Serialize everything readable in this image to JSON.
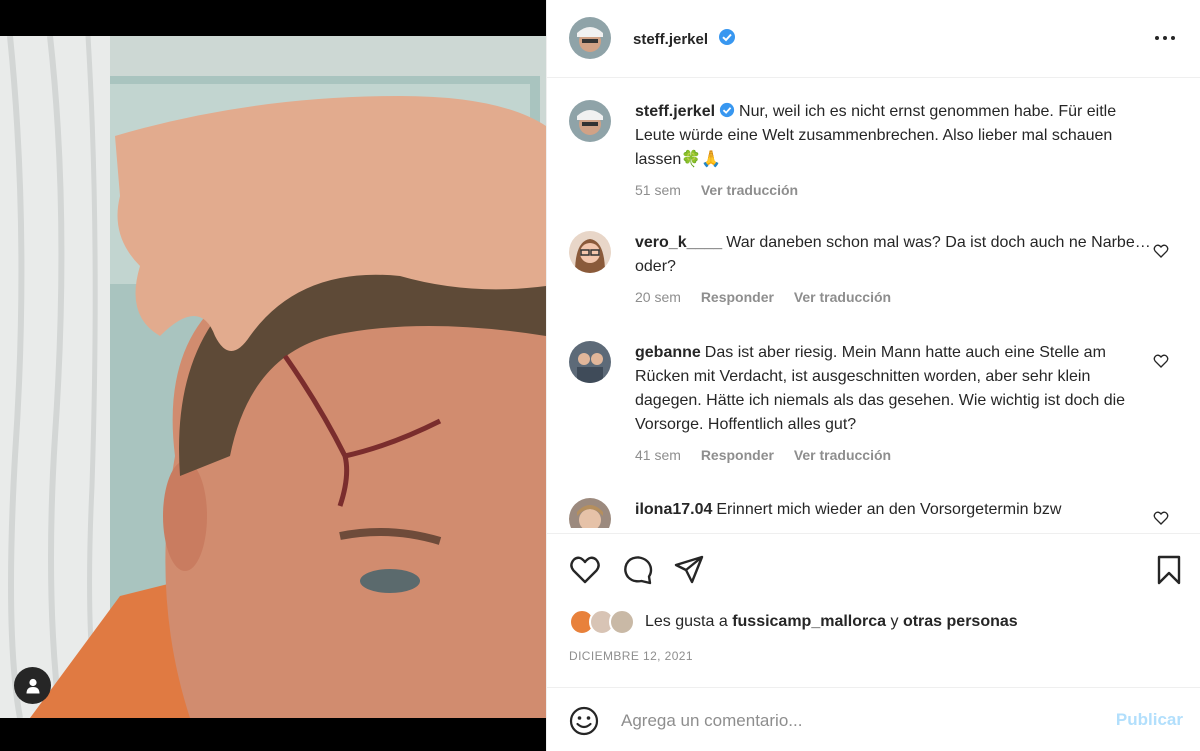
{
  "post": {
    "username": "steff.jerkel",
    "verified": true,
    "caption": "Nur, weil ich es nicht ernst genommen habe. Für eitle Leute würde eine Welt zusammenbrechen. Also lieber mal schauen lassen🍀🙏",
    "caption_time": "51 sem",
    "translate_label": "Ver traducción"
  },
  "comments": [
    {
      "username": "vero_k____",
      "text": "War daneben schon mal was? Da ist doch auch ne Narbe…oder?",
      "time": "20 sem",
      "reply_label": "Responder",
      "translate_label": "Ver traducción"
    },
    {
      "username": "gebanne",
      "text": "Das ist aber riesig. Mein Mann hatte auch eine Stelle am Rücken mit Verdacht, ist ausgeschnitten worden, aber sehr klein dagegen. Hätte ich niemals als das gesehen. Wie wichtig ist doch die Vorsorge. Hoffentlich alles gut?",
      "time": "41 sem",
      "reply_label": "Responder",
      "translate_label": "Ver traducción"
    },
    {
      "username": "ilona17.04",
      "text": "Erinnert mich wieder an den Vorsorgetermin bzw"
    }
  ],
  "likes": {
    "prefix": "Les gusta a",
    "user": "fussicamp_mallorca",
    "joiner": "y",
    "others": "otras personas"
  },
  "date": "DICIEMBRE 12, 2021",
  "add_comment": {
    "placeholder": "Agrega un comentario...",
    "publish_label": "Publicar"
  },
  "colors": {
    "verified": "#3897f0",
    "publish_disabled": "#b2dffc",
    "secondary_text": "#8e8e8e"
  },
  "icons": [
    "more-icon",
    "heart-icon",
    "comment-icon",
    "share-icon",
    "bookmark-icon",
    "emoji-icon",
    "user-tag-icon",
    "verified-badge-icon"
  ]
}
